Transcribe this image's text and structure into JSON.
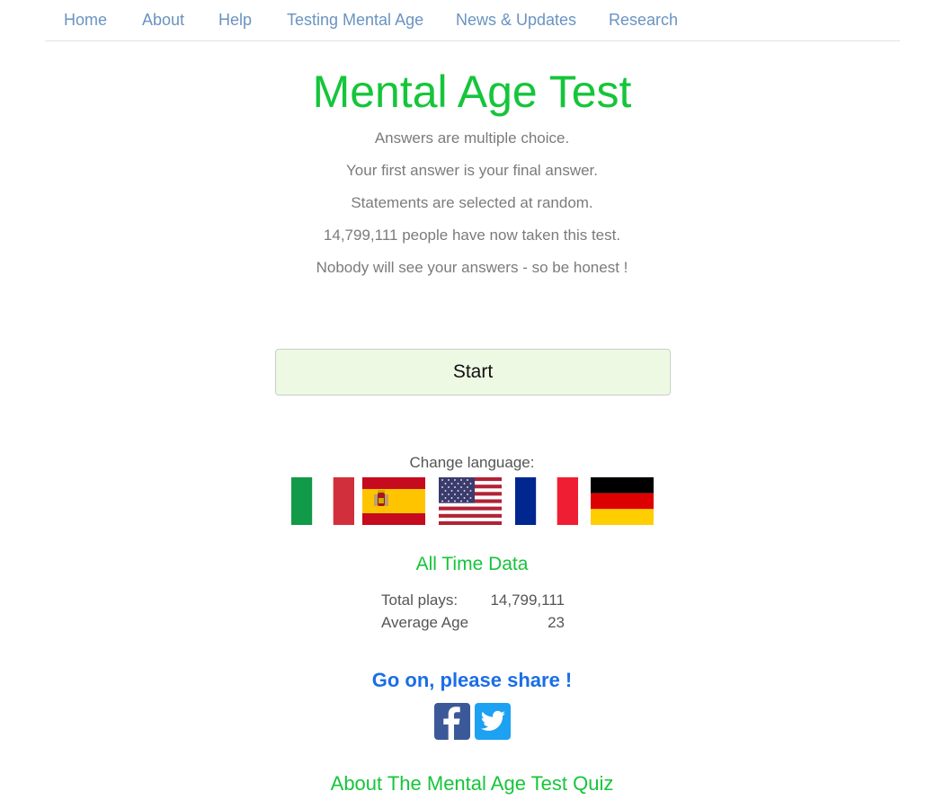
{
  "nav": {
    "items": [
      {
        "label": "Home"
      },
      {
        "label": "About"
      },
      {
        "label": "Help"
      },
      {
        "label": "Testing Mental Age"
      },
      {
        "label": "News & Updates"
      },
      {
        "label": "Research"
      }
    ]
  },
  "header": {
    "title": "Mental Age Test"
  },
  "intro": {
    "lines": [
      "Answers are multiple choice.",
      "Your first answer is your final answer.",
      "Statements are selected at random.",
      "14,799,111 people have now taken this test.",
      "Nobody will see your answers - so be honest !"
    ]
  },
  "start_button": {
    "label": "Start"
  },
  "language": {
    "label": "Change language:",
    "flags": [
      {
        "name": "Italian",
        "icon": "italy-flag-icon"
      },
      {
        "name": "Spanish",
        "icon": "spain-flag-icon"
      },
      {
        "name": "English",
        "icon": "usa-flag-icon"
      },
      {
        "name": "French",
        "icon": "france-flag-icon"
      },
      {
        "name": "German",
        "icon": "germany-flag-icon"
      }
    ]
  },
  "all_time": {
    "title": "All Time Data",
    "rows": [
      {
        "label": "Total plays:",
        "value": "14,799,111"
      },
      {
        "label": "Average Age",
        "value": "23"
      }
    ]
  },
  "share": {
    "title": "Go on, please share !",
    "buttons": [
      {
        "name": "Facebook",
        "icon": "facebook-icon",
        "color": "#3b5998"
      },
      {
        "name": "Twitter",
        "icon": "twitter-icon",
        "color": "#1da1f2"
      }
    ]
  },
  "footer": {
    "about_link": "About The Mental Age Test Quiz"
  },
  "colors": {
    "accent_green": "#15c53a",
    "nav_link": "#6a93c1",
    "share_blue": "#1a6ee6",
    "start_bg": "#eef9e4"
  }
}
